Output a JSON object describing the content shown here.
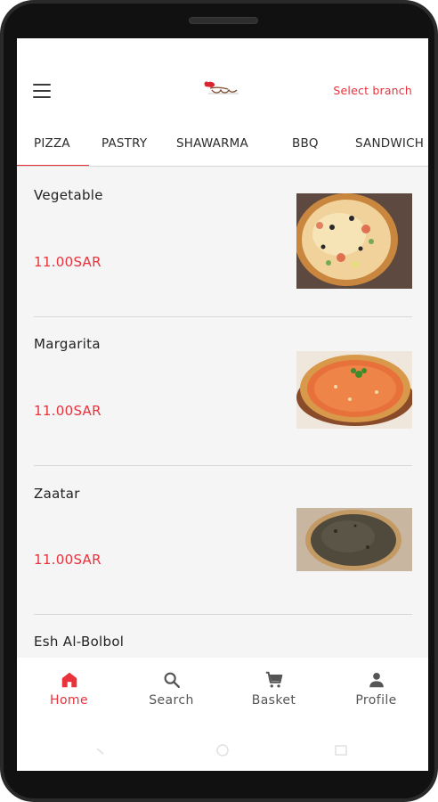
{
  "header": {
    "select_branch": "Select branch"
  },
  "tabs": [
    {
      "label": "PIZZA",
      "active": true
    },
    {
      "label": "PASTRY",
      "active": false
    },
    {
      "label": "SHAWARMA",
      "active": false
    },
    {
      "label": "BBQ",
      "active": false
    },
    {
      "label": "SANDWICH",
      "active": false
    }
  ],
  "items": [
    {
      "name": "Vegetable",
      "price": "11.00SAR"
    },
    {
      "name": "Margarita",
      "price": "11.00SAR"
    },
    {
      "name": "Zaatar",
      "price": "11.00SAR"
    },
    {
      "name": "Esh Al-Bolbol",
      "price": ""
    }
  ],
  "nav": [
    {
      "label": "Home",
      "icon": "home-icon",
      "active": true
    },
    {
      "label": "Search",
      "icon": "search-icon",
      "active": false
    },
    {
      "label": "Basket",
      "icon": "cart-icon",
      "active": false
    },
    {
      "label": "Profile",
      "icon": "person-icon",
      "active": false
    }
  ],
  "colors": {
    "accent": "#e8323c",
    "background": "#f5f5f5"
  }
}
